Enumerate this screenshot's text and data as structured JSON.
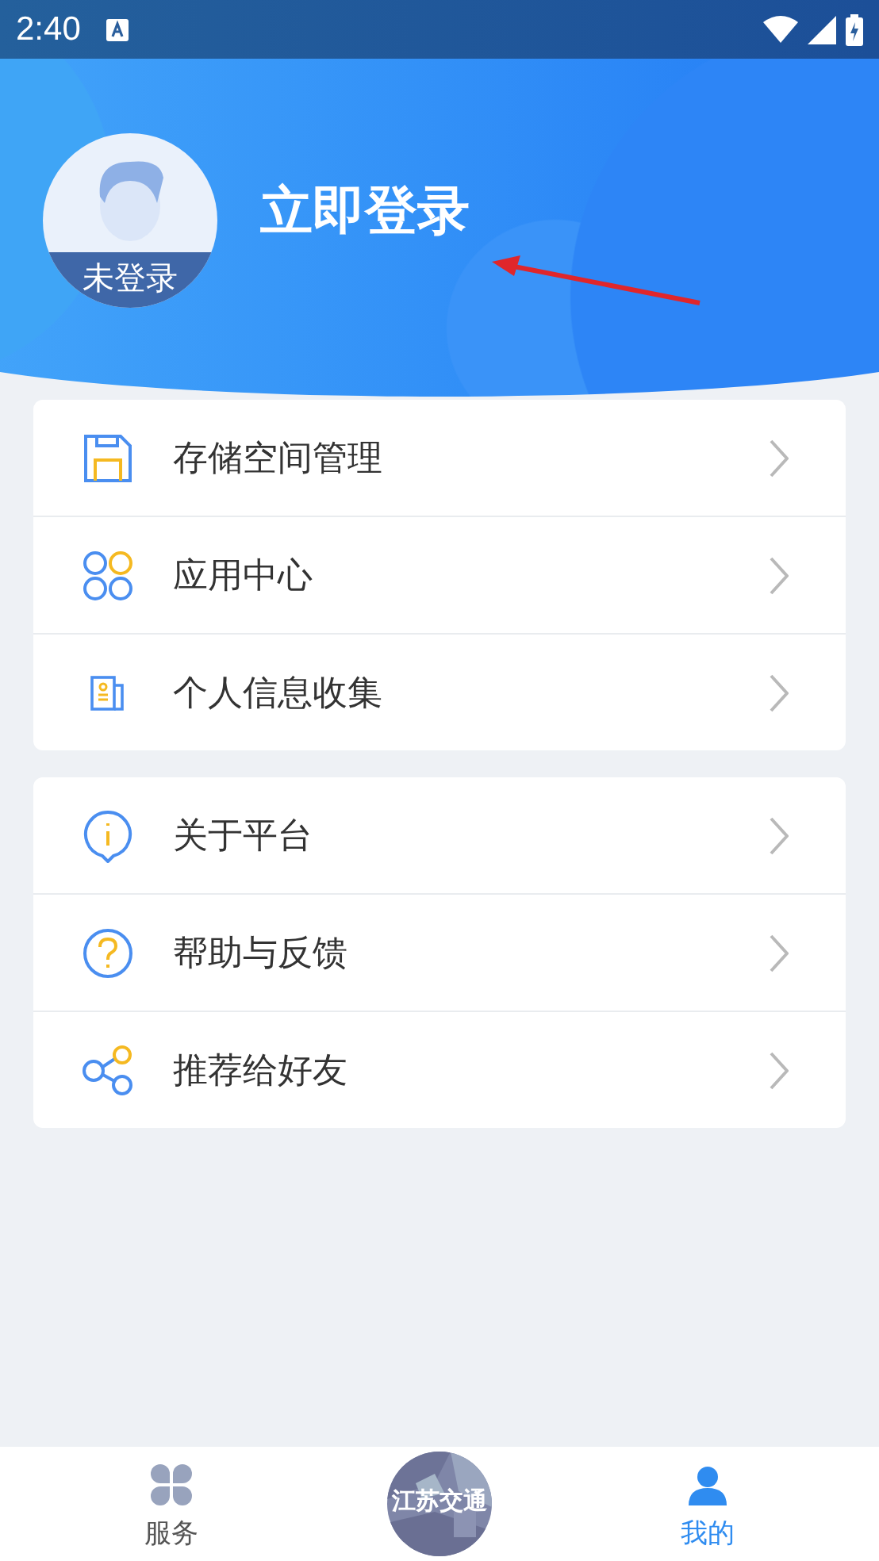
{
  "status_bar": {
    "time": "2:40"
  },
  "profile": {
    "login_prompt": "立即登录",
    "avatar_label": "未登录"
  },
  "menu_groups": [
    {
      "items": [
        {
          "kind": "storage",
          "label": "存储空间管理"
        },
        {
          "kind": "apps",
          "label": "应用中心"
        },
        {
          "kind": "document",
          "label": "个人信息收集"
        }
      ]
    },
    {
      "items": [
        {
          "kind": "info",
          "label": "关于平台"
        },
        {
          "kind": "help",
          "label": "帮助与反馈"
        },
        {
          "kind": "share",
          "label": "推荐给好友"
        }
      ]
    }
  ],
  "bottom_nav": [
    {
      "kind": "services",
      "label": "服务",
      "selected": false
    },
    {
      "kind": "logo",
      "label": "江苏交通"
    },
    {
      "kind": "profile",
      "label": "我的",
      "selected": true
    }
  ]
}
